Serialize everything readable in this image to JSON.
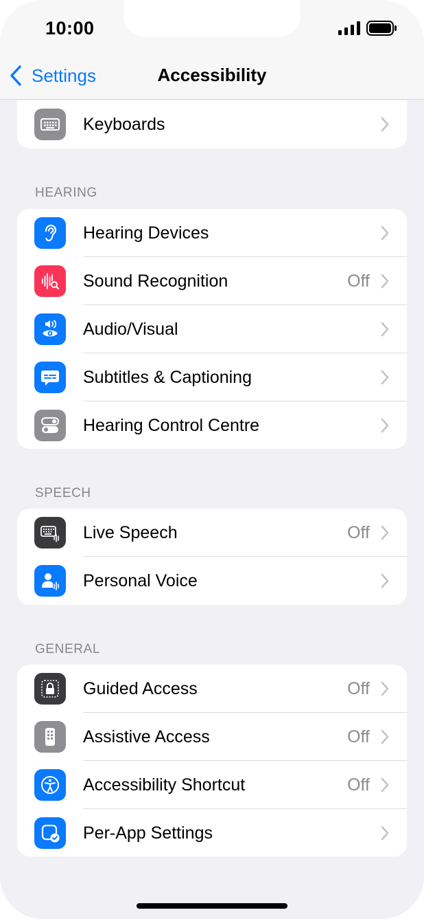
{
  "status_bar": {
    "time": "10:00"
  },
  "nav": {
    "back_label": "Settings",
    "title": "Accessibility"
  },
  "top_group": {
    "items": [
      {
        "label": "Keyboards",
        "value": "",
        "icon": "keyboard-icon"
      }
    ]
  },
  "hearing": {
    "title": "HEARING",
    "items": [
      {
        "label": "Hearing Devices",
        "value": "",
        "icon": "ear-icon"
      },
      {
        "label": "Sound Recognition",
        "value": "Off",
        "icon": "sound-recognition-icon"
      },
      {
        "label": "Audio/Visual",
        "value": "",
        "icon": "audio-visual-icon"
      },
      {
        "label": "Subtitles & Captioning",
        "value": "",
        "icon": "subtitles-icon"
      },
      {
        "label": "Hearing Control Centre",
        "value": "",
        "icon": "toggles-icon"
      }
    ]
  },
  "speech": {
    "title": "SPEECH",
    "items": [
      {
        "label": "Live Speech",
        "value": "Off",
        "icon": "live-speech-icon"
      },
      {
        "label": "Personal Voice",
        "value": "",
        "icon": "personal-voice-icon"
      }
    ]
  },
  "general": {
    "title": "GENERAL",
    "items": [
      {
        "label": "Guided Access",
        "value": "Off",
        "icon": "lock-icon"
      },
      {
        "label": "Assistive Access",
        "value": "Off",
        "icon": "assistive-access-icon"
      },
      {
        "label": "Accessibility Shortcut",
        "value": "Off",
        "icon": "accessibility-icon"
      },
      {
        "label": "Per-App Settings",
        "value": "",
        "icon": "per-app-icon"
      }
    ]
  },
  "colors": {
    "accent": "#0a7aff",
    "background": "#f0f0f5",
    "secondary_text": "#8a8a8e",
    "sound_recognition_icon_bg": "#fb3457"
  }
}
